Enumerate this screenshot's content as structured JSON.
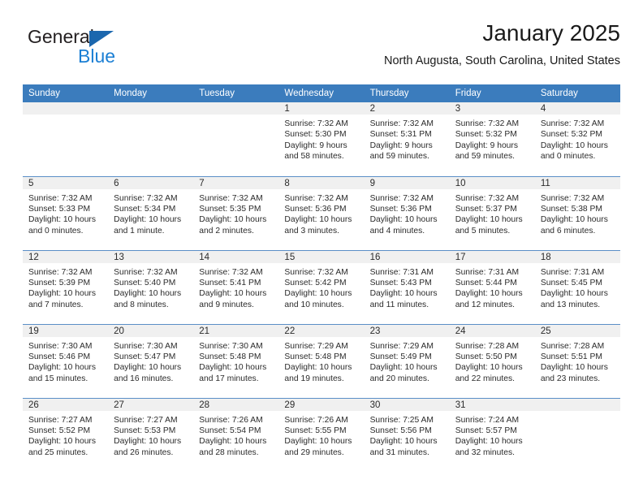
{
  "brand": {
    "name_part1": "General",
    "name_part2": "Blue",
    "triangle_icon": "triangle-logo-icon",
    "accent_dark": "#1b67ae",
    "accent_light": "#1b7fd4"
  },
  "header": {
    "title": "January 2025",
    "subtitle": "North Augusta, South Carolina, United States"
  },
  "calendar": {
    "header_bg": "#3b7cbd",
    "daynum_bg": "#f0f0f0",
    "grid_line": "#5b8fc7",
    "weekday_headers": [
      "Sunday",
      "Monday",
      "Tuesday",
      "Wednesday",
      "Thursday",
      "Friday",
      "Saturday"
    ],
    "weeks": [
      [
        {
          "day": "",
          "lines": []
        },
        {
          "day": "",
          "lines": []
        },
        {
          "day": "",
          "lines": []
        },
        {
          "day": "1",
          "lines": [
            "Sunrise: 7:32 AM",
            "Sunset: 5:30 PM",
            "Daylight: 9 hours",
            "and 58 minutes."
          ]
        },
        {
          "day": "2",
          "lines": [
            "Sunrise: 7:32 AM",
            "Sunset: 5:31 PM",
            "Daylight: 9 hours",
            "and 59 minutes."
          ]
        },
        {
          "day": "3",
          "lines": [
            "Sunrise: 7:32 AM",
            "Sunset: 5:32 PM",
            "Daylight: 9 hours",
            "and 59 minutes."
          ]
        },
        {
          "day": "4",
          "lines": [
            "Sunrise: 7:32 AM",
            "Sunset: 5:32 PM",
            "Daylight: 10 hours",
            "and 0 minutes."
          ]
        }
      ],
      [
        {
          "day": "5",
          "lines": [
            "Sunrise: 7:32 AM",
            "Sunset: 5:33 PM",
            "Daylight: 10 hours",
            "and 0 minutes."
          ]
        },
        {
          "day": "6",
          "lines": [
            "Sunrise: 7:32 AM",
            "Sunset: 5:34 PM",
            "Daylight: 10 hours",
            "and 1 minute."
          ]
        },
        {
          "day": "7",
          "lines": [
            "Sunrise: 7:32 AM",
            "Sunset: 5:35 PM",
            "Daylight: 10 hours",
            "and 2 minutes."
          ]
        },
        {
          "day": "8",
          "lines": [
            "Sunrise: 7:32 AM",
            "Sunset: 5:36 PM",
            "Daylight: 10 hours",
            "and 3 minutes."
          ]
        },
        {
          "day": "9",
          "lines": [
            "Sunrise: 7:32 AM",
            "Sunset: 5:36 PM",
            "Daylight: 10 hours",
            "and 4 minutes."
          ]
        },
        {
          "day": "10",
          "lines": [
            "Sunrise: 7:32 AM",
            "Sunset: 5:37 PM",
            "Daylight: 10 hours",
            "and 5 minutes."
          ]
        },
        {
          "day": "11",
          "lines": [
            "Sunrise: 7:32 AM",
            "Sunset: 5:38 PM",
            "Daylight: 10 hours",
            "and 6 minutes."
          ]
        }
      ],
      [
        {
          "day": "12",
          "lines": [
            "Sunrise: 7:32 AM",
            "Sunset: 5:39 PM",
            "Daylight: 10 hours",
            "and 7 minutes."
          ]
        },
        {
          "day": "13",
          "lines": [
            "Sunrise: 7:32 AM",
            "Sunset: 5:40 PM",
            "Daylight: 10 hours",
            "and 8 minutes."
          ]
        },
        {
          "day": "14",
          "lines": [
            "Sunrise: 7:32 AM",
            "Sunset: 5:41 PM",
            "Daylight: 10 hours",
            "and 9 minutes."
          ]
        },
        {
          "day": "15",
          "lines": [
            "Sunrise: 7:32 AM",
            "Sunset: 5:42 PM",
            "Daylight: 10 hours",
            "and 10 minutes."
          ]
        },
        {
          "day": "16",
          "lines": [
            "Sunrise: 7:31 AM",
            "Sunset: 5:43 PM",
            "Daylight: 10 hours",
            "and 11 minutes."
          ]
        },
        {
          "day": "17",
          "lines": [
            "Sunrise: 7:31 AM",
            "Sunset: 5:44 PM",
            "Daylight: 10 hours",
            "and 12 minutes."
          ]
        },
        {
          "day": "18",
          "lines": [
            "Sunrise: 7:31 AM",
            "Sunset: 5:45 PM",
            "Daylight: 10 hours",
            "and 13 minutes."
          ]
        }
      ],
      [
        {
          "day": "19",
          "lines": [
            "Sunrise: 7:30 AM",
            "Sunset: 5:46 PM",
            "Daylight: 10 hours",
            "and 15 minutes."
          ]
        },
        {
          "day": "20",
          "lines": [
            "Sunrise: 7:30 AM",
            "Sunset: 5:47 PM",
            "Daylight: 10 hours",
            "and 16 minutes."
          ]
        },
        {
          "day": "21",
          "lines": [
            "Sunrise: 7:30 AM",
            "Sunset: 5:48 PM",
            "Daylight: 10 hours",
            "and 17 minutes."
          ]
        },
        {
          "day": "22",
          "lines": [
            "Sunrise: 7:29 AM",
            "Sunset: 5:48 PM",
            "Daylight: 10 hours",
            "and 19 minutes."
          ]
        },
        {
          "day": "23",
          "lines": [
            "Sunrise: 7:29 AM",
            "Sunset: 5:49 PM",
            "Daylight: 10 hours",
            "and 20 minutes."
          ]
        },
        {
          "day": "24",
          "lines": [
            "Sunrise: 7:28 AM",
            "Sunset: 5:50 PM",
            "Daylight: 10 hours",
            "and 22 minutes."
          ]
        },
        {
          "day": "25",
          "lines": [
            "Sunrise: 7:28 AM",
            "Sunset: 5:51 PM",
            "Daylight: 10 hours",
            "and 23 minutes."
          ]
        }
      ],
      [
        {
          "day": "26",
          "lines": [
            "Sunrise: 7:27 AM",
            "Sunset: 5:52 PM",
            "Daylight: 10 hours",
            "and 25 minutes."
          ]
        },
        {
          "day": "27",
          "lines": [
            "Sunrise: 7:27 AM",
            "Sunset: 5:53 PM",
            "Daylight: 10 hours",
            "and 26 minutes."
          ]
        },
        {
          "day": "28",
          "lines": [
            "Sunrise: 7:26 AM",
            "Sunset: 5:54 PM",
            "Daylight: 10 hours",
            "and 28 minutes."
          ]
        },
        {
          "day": "29",
          "lines": [
            "Sunrise: 7:26 AM",
            "Sunset: 5:55 PM",
            "Daylight: 10 hours",
            "and 29 minutes."
          ]
        },
        {
          "day": "30",
          "lines": [
            "Sunrise: 7:25 AM",
            "Sunset: 5:56 PM",
            "Daylight: 10 hours",
            "and 31 minutes."
          ]
        },
        {
          "day": "31",
          "lines": [
            "Sunrise: 7:24 AM",
            "Sunset: 5:57 PM",
            "Daylight: 10 hours",
            "and 32 minutes."
          ]
        },
        {
          "day": "",
          "lines": []
        }
      ]
    ]
  }
}
